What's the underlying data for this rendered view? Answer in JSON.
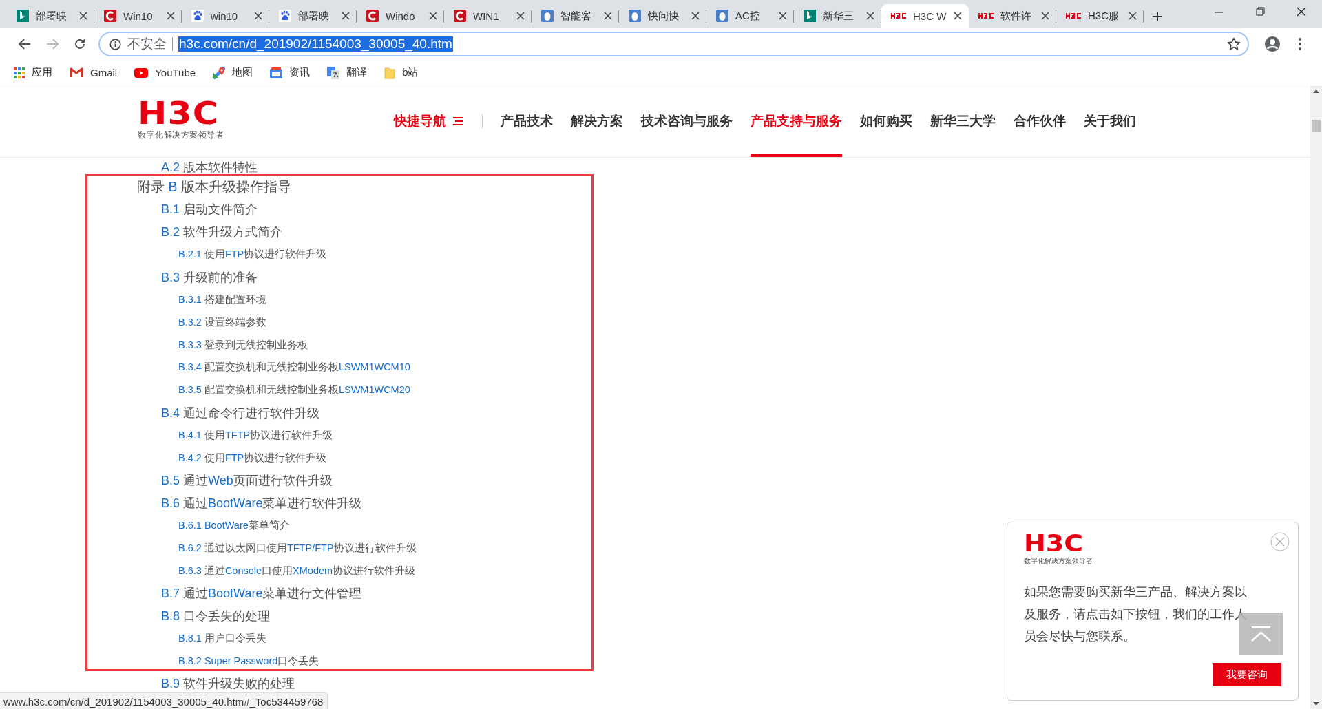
{
  "tabs": [
    {
      "title": "部署映",
      "kind": "bing",
      "selected": false
    },
    {
      "title": "Win10",
      "kind": "csdn",
      "selected": false
    },
    {
      "title": "win10",
      "kind": "baidu",
      "selected": false
    },
    {
      "title": "部署映",
      "kind": "baidu",
      "selected": false
    },
    {
      "title": "Windo",
      "kind": "csdn",
      "selected": false
    },
    {
      "title": "WIN1",
      "kind": "csdn",
      "selected": false
    },
    {
      "title": "智能客",
      "kind": "bubble",
      "selected": false
    },
    {
      "title": "快问快",
      "kind": "bubble",
      "selected": false
    },
    {
      "title": "AC控",
      "kind": "bubble",
      "selected": false
    },
    {
      "title": "新华三",
      "kind": "bing",
      "selected": false
    },
    {
      "title": "H3C W",
      "kind": "h3c",
      "selected": true
    },
    {
      "title": "软件许",
      "kind": "h3c",
      "selected": false
    },
    {
      "title": "H3C服",
      "kind": "h3c",
      "selected": false
    }
  ],
  "address_bar": {
    "security": "不安全",
    "url": "h3c.com/cn/d_201902/1154003_30005_40.htm",
    "highlighted": true
  },
  "bookmarks": [
    {
      "label": "应用",
      "kind": "apps"
    },
    {
      "label": "Gmail",
      "kind": "gmail"
    },
    {
      "label": "YouTube",
      "kind": "youtube"
    },
    {
      "label": "地图",
      "kind": "maps"
    },
    {
      "label": "资讯",
      "kind": "news"
    },
    {
      "label": "翻译",
      "kind": "translate"
    },
    {
      "label": "b站",
      "kind": "folder"
    }
  ],
  "site_header": {
    "logo": "H3C",
    "tagline": "数字化解决方案领导者",
    "nav": [
      {
        "label": "快捷导航",
        "kind": "quick",
        "selected": false
      },
      {
        "label": "产品技术",
        "kind": "link",
        "selected": false
      },
      {
        "label": "解决方案",
        "kind": "link",
        "selected": false
      },
      {
        "label": "技术咨询与服务",
        "kind": "link",
        "selected": false
      },
      {
        "label": "产品支持与服务",
        "kind": "link",
        "selected": true
      },
      {
        "label": "如何购买",
        "kind": "link",
        "selected": false
      },
      {
        "label": "新华三大学",
        "kind": "link",
        "selected": false
      },
      {
        "label": "合作伙伴",
        "kind": "link",
        "selected": false
      },
      {
        "label": "关于我们",
        "kind": "link",
        "selected": false
      }
    ]
  },
  "toc": [
    {
      "label": "A.2 版本软件特性",
      "kind": "section"
    },
    {
      "label": "附录 B 版本升级操作指导",
      "kind": "appendix",
      "children": [
        {
          "label": "B.1 启动文件简介",
          "kind": "section"
        },
        {
          "label": "B.2 软件升级方式简介",
          "kind": "section",
          "children": [
            {
              "label": "B.2.1 使用FTP协议进行软件升级",
              "kind": "subsection"
            }
          ]
        },
        {
          "label": "B.3 升级前的准备",
          "kind": "section",
          "children": [
            {
              "label": "B.3.1 搭建配置环境",
              "kind": "subsection"
            },
            {
              "label": "B.3.2 设置终端参数",
              "kind": "subsection"
            },
            {
              "label": "B.3.3 登录到无线控制业务板",
              "kind": "subsection"
            },
            {
              "label": "B.3.4 配置交换机和无线控制业务板LSWM1WCM10",
              "kind": "subsection"
            },
            {
              "label": "B.3.5 配置交换机和无线控制业务板LSWM1WCM20",
              "kind": "subsection"
            }
          ]
        },
        {
          "label": "B.4 通过命令行进行软件升级",
          "kind": "section",
          "children": [
            {
              "label": "B.4.1 使用TFTP协议进行软件升级",
              "kind": "subsection"
            },
            {
              "label": "B.4.2 使用FTP协议进行软件升级",
              "kind": "subsection"
            }
          ]
        },
        {
          "label": "B.5 通过Web页面进行软件升级",
          "kind": "section"
        },
        {
          "label": "B.6 通过BootWare菜单进行软件升级",
          "kind": "section",
          "children": [
            {
              "label": "B.6.1 BootWare菜单简介",
              "kind": "subsection"
            },
            {
              "label": "B.6.2 通过以太网口使用TFTP/FTP协议进行软件升级",
              "kind": "subsection"
            },
            {
              "label": "B.6.3 通过Console口使用XModem协议进行软件升级",
              "kind": "subsection"
            }
          ]
        },
        {
          "label": "B.7 通过BootWare菜单进行文件管理",
          "kind": "section"
        },
        {
          "label": "B.8 口令丢失的处理",
          "kind": "section",
          "children": [
            {
              "label": "B.8.1 用户口令丢失",
              "kind": "subsection"
            },
            {
              "label": "B.8.2 Super Password口令丢失",
              "kind": "subsection"
            }
          ]
        },
        {
          "label": "B.9 软件升级失败的处理",
          "kind": "section"
        }
      ]
    }
  ],
  "popup": {
    "logo": "H3C",
    "tagline": "数字化解决方案领导者",
    "message": "如果您需要购买新华三产品、解决方案以及服务，请点击如下按钮，我们的工作人员会尽快与您联系。",
    "button": "我要咨询"
  },
  "status_url": "www.h3c.com/cn/d_201902/1154003_30005_40.htm#_Toc534459768"
}
